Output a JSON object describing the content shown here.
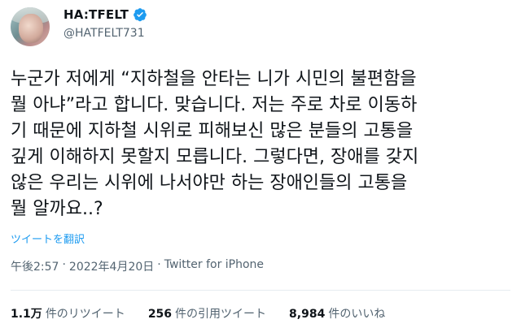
{
  "user": {
    "display_name": "HA:TFELT",
    "handle": "@HATFELT731"
  },
  "tweet": {
    "lines": [
      "누군가 저에게 “지하철을 안타는 니가 시민의 불편함을",
      "뭘 아냐”라고 합니다. 맞습니다. 저는 주로 차로 이동하",
      "기 때문에 지하철 시위로 피해보신 많은 분들의 고통을",
      "깊게 이해하지 못할지 모릅니다. 그렇다면, 장애를 갖지",
      "않은 우리는 시위에 나서야만 하는 장애인들의 고통을",
      "뭘 알까요..?"
    ],
    "translate_label": "ツイートを翻訳",
    "time": "午後2:57",
    "separator": "·",
    "date": "2022年4月20日",
    "source": "Twitter for iPhone"
  },
  "stats": {
    "retweets": {
      "value": "1.1万",
      "label": "件のリツイート"
    },
    "quotes": {
      "value": "256",
      "label": "件の引用ツイート"
    },
    "likes": {
      "value": "8,984",
      "label": "件のいいね"
    }
  },
  "colors": {
    "accent": "#1d9bf0",
    "text": "#0f1419",
    "muted": "#536471",
    "divider": "#e6ecf0"
  },
  "icons": {
    "verified": "verified-badge-icon"
  }
}
